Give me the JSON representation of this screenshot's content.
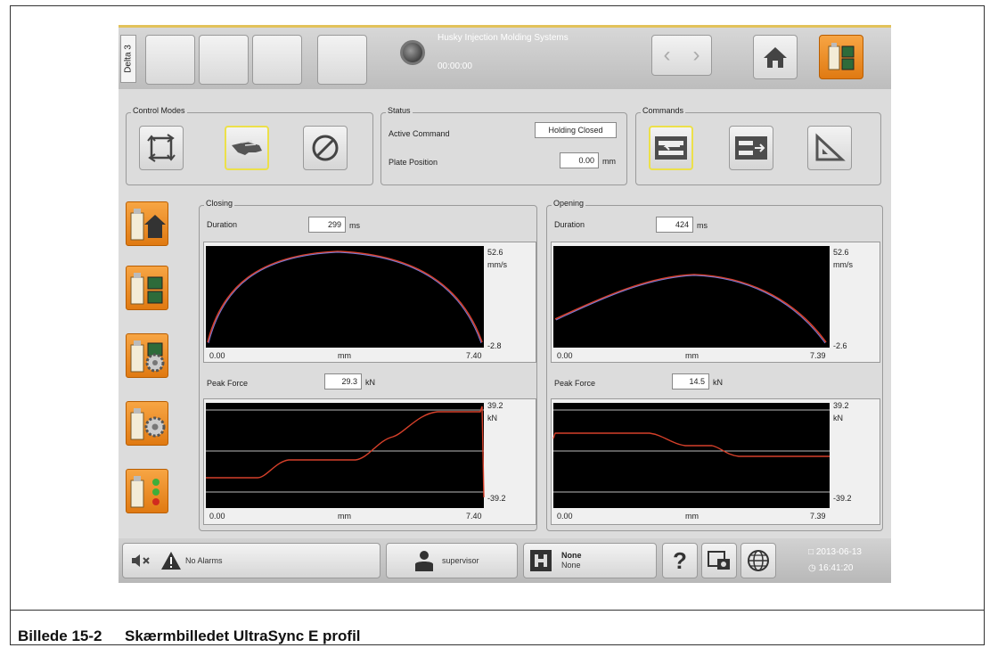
{
  "header": {
    "delta_label": "Delta 3",
    "system_title": "Husky Injection Molding Systems",
    "timer": "00:00:00"
  },
  "control_modes": {
    "legend": "Control Modes",
    "buttons": [
      {
        "icon": "cycle-mode-icon",
        "selected": false
      },
      {
        "icon": "manual-hand-icon",
        "selected": true
      },
      {
        "icon": "disabled-icon",
        "selected": false
      }
    ]
  },
  "status": {
    "legend": "Status",
    "active_command_label": "Active Command",
    "active_command_value": "Holding Closed",
    "plate_position_label": "Plate Position",
    "plate_position_value": "0.00",
    "plate_position_unit": "mm"
  },
  "commands": {
    "legend": "Commands",
    "buttons": [
      {
        "icon": "close-plate-icon",
        "selected": true
      },
      {
        "icon": "open-plate-icon",
        "selected": false
      },
      {
        "icon": "setup-triangle-icon",
        "selected": false
      }
    ]
  },
  "sidebar": {
    "items": [
      {
        "icon": "home-screen-icon"
      },
      {
        "icon": "profile-screen-icon"
      },
      {
        "icon": "settings-gear-screen-icon"
      },
      {
        "icon": "parameters-gear-screen-icon"
      },
      {
        "icon": "io-status-screen-icon"
      }
    ]
  },
  "closing": {
    "legend": "Closing",
    "duration_label": "Duration",
    "duration_value": "299",
    "duration_unit": "ms",
    "velocity_max": "52.6",
    "velocity_unit": "mm/s",
    "velocity_min": "-2.8",
    "x_min": "0.00",
    "x_unit": "mm",
    "x_max": "7.40",
    "peak_force_label": "Peak Force",
    "peak_force_value": "29.3",
    "peak_force_unit": "kN",
    "force_max": "39.2",
    "force_unit": "kN",
    "force_min": "-39.2",
    "force_x_min": "0.00",
    "force_x_unit": "mm",
    "force_x_max": "7.40"
  },
  "opening": {
    "legend": "Opening",
    "duration_label": "Duration",
    "duration_value": "424",
    "duration_unit": "ms",
    "velocity_max": "52.6",
    "velocity_unit": "mm/s",
    "velocity_min": "-2.6",
    "x_min": "0.00",
    "x_unit": "mm",
    "x_max": "7.39",
    "peak_force_label": "Peak Force",
    "peak_force_value": "14.5",
    "peak_force_unit": "kN",
    "force_max": "39.2",
    "force_unit": "kN",
    "force_min": "-39.2",
    "force_x_min": "0.00",
    "force_x_unit": "mm",
    "force_x_max": "7.39"
  },
  "footer": {
    "alarms_text": "No Alarms",
    "user_text": "supervisor",
    "mold_line1": "None",
    "mold_line2": "None",
    "date": "2013-06-13",
    "time": "16:41:20"
  },
  "caption": {
    "number": "Billede 15-2",
    "title": "Skærmbilledet UltraSync E profil"
  },
  "colors": {
    "accent_orange": "#e88a1c",
    "selection_yellow": "#ece04a",
    "plot_background": "#000000",
    "trace_red": "#d6402a"
  }
}
